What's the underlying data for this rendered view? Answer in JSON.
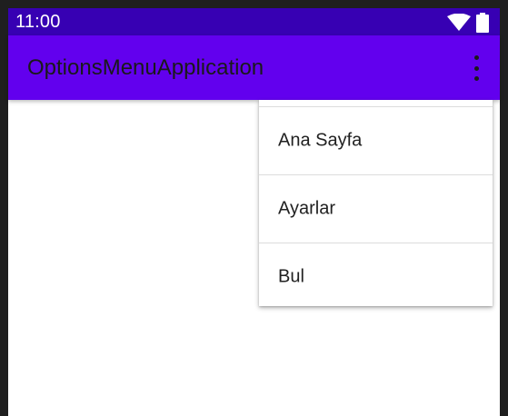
{
  "status_bar": {
    "time": "11:00",
    "icons": [
      "wifi-icon",
      "battery-icon"
    ],
    "background": "#3700b3"
  },
  "app_bar": {
    "title": "OptionsMenuApplication",
    "overflow_icon": "more-vert-icon",
    "background": "#6200ee"
  },
  "options_menu": {
    "items": [
      {
        "label": "Ana Sayfa"
      },
      {
        "label": "Ayarlar"
      },
      {
        "label": "Bul"
      }
    ]
  }
}
